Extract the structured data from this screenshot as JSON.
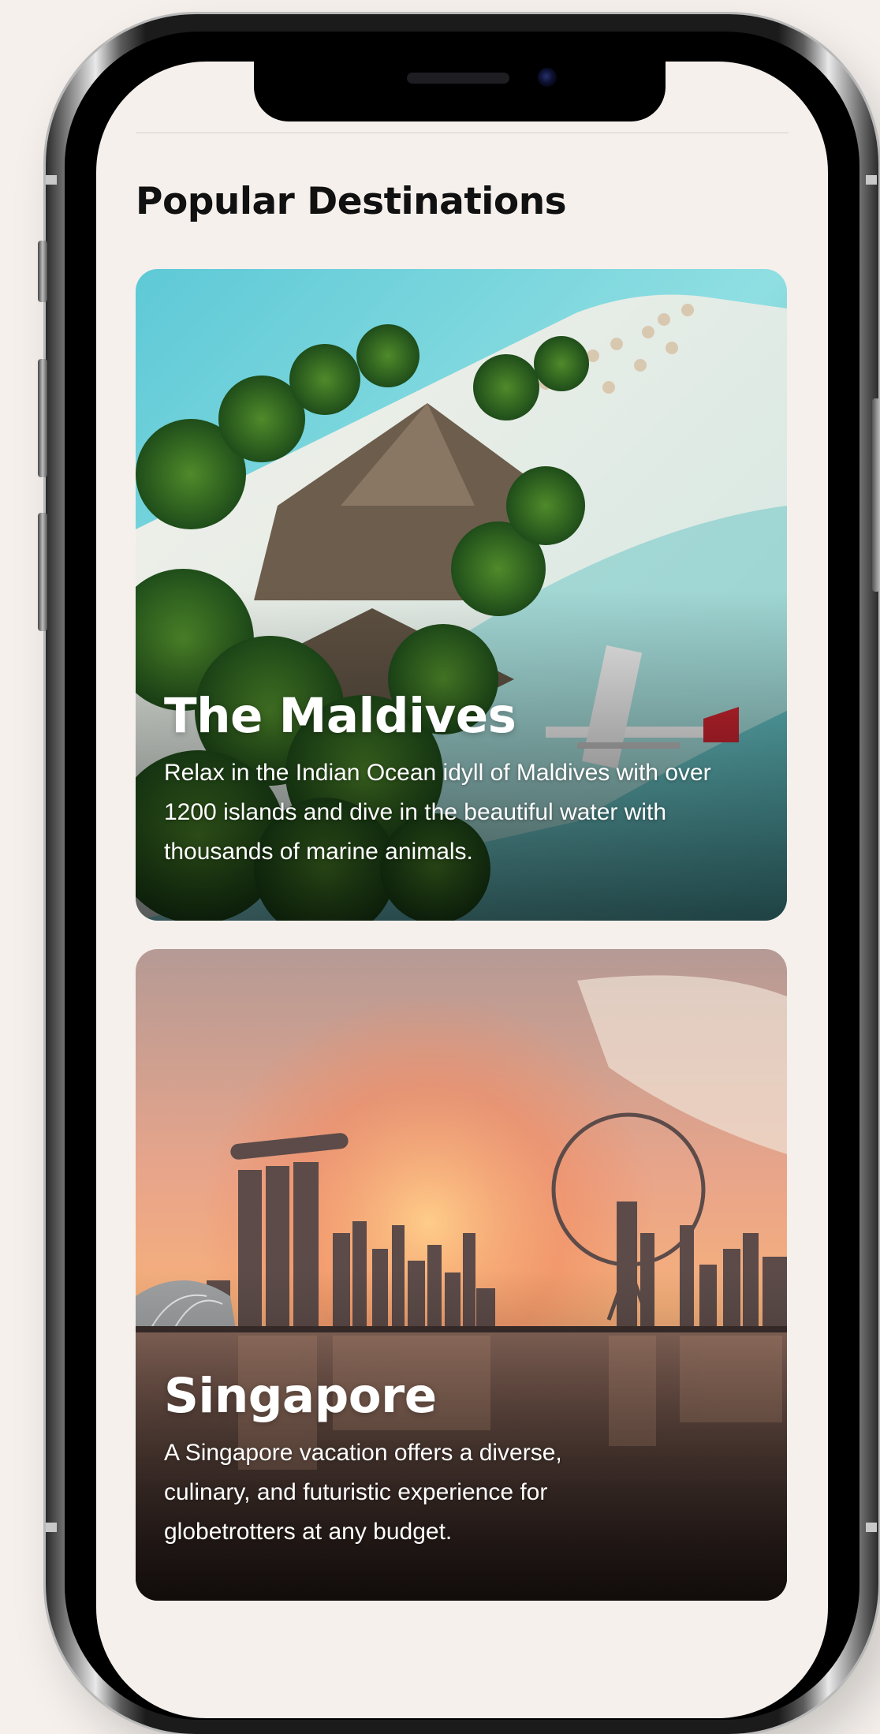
{
  "page": {
    "section_title": "Popular Destinations"
  },
  "destinations": [
    {
      "name": "The Maldives",
      "description": "Relax in the Indian Ocean idyll of Maldives with over 1200 islands and dive in the beautiful water with thousands of marine animals."
    },
    {
      "name": "Singapore",
      "description": "A Singapore vacation offers a diverse, culinary, and futuristic experience for globetrotters at any budget."
    }
  ],
  "colors": {
    "background": "#f5f0ec",
    "title_text": "#111111",
    "card_text": "#ffffff"
  }
}
